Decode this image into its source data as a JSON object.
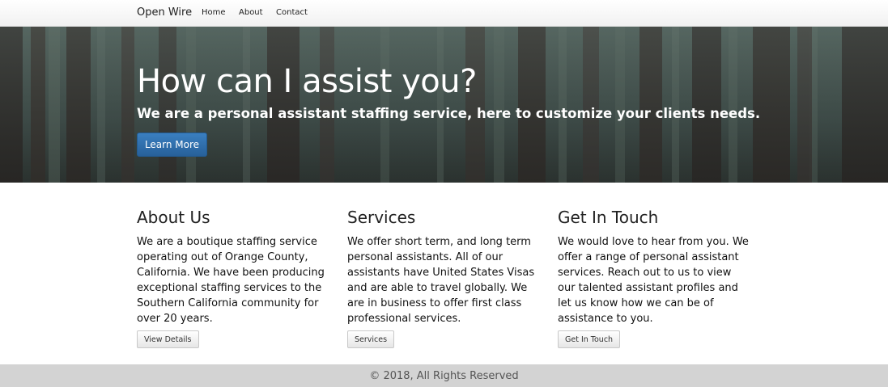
{
  "navbar": {
    "brand": "Open Wire",
    "links": [
      "Home",
      "About",
      "Contact"
    ]
  },
  "hero": {
    "title": "How can I assist you?",
    "subtitle": "We are a personal assistant staffing service, here to customize your clients needs.",
    "button_label": "Learn More",
    "button_color": "#2d6ca8"
  },
  "columns": [
    {
      "heading": "About Us",
      "body": "We are a boutique staffing service operating out of Orange County, California. We have been producing exceptional staffing services to the Southern California community for over 20 years.",
      "button_label": "View Details"
    },
    {
      "heading": "Services",
      "body": "We offer short term, and long term personal assistants. All of our assistants have United States Visas and are able to travel globally. We are in business to offer first class professional services.",
      "button_label": "Services"
    },
    {
      "heading": "Get In Touch",
      "body": "We would love to hear from you. We offer a range of personal assistant services. Reach out to us to view our talented assistant profiles and let us know how we can be of assistance to you.",
      "button_label": "Get In Touch"
    }
  ],
  "footer": {
    "text": "© 2018, All Rights Reserved"
  }
}
